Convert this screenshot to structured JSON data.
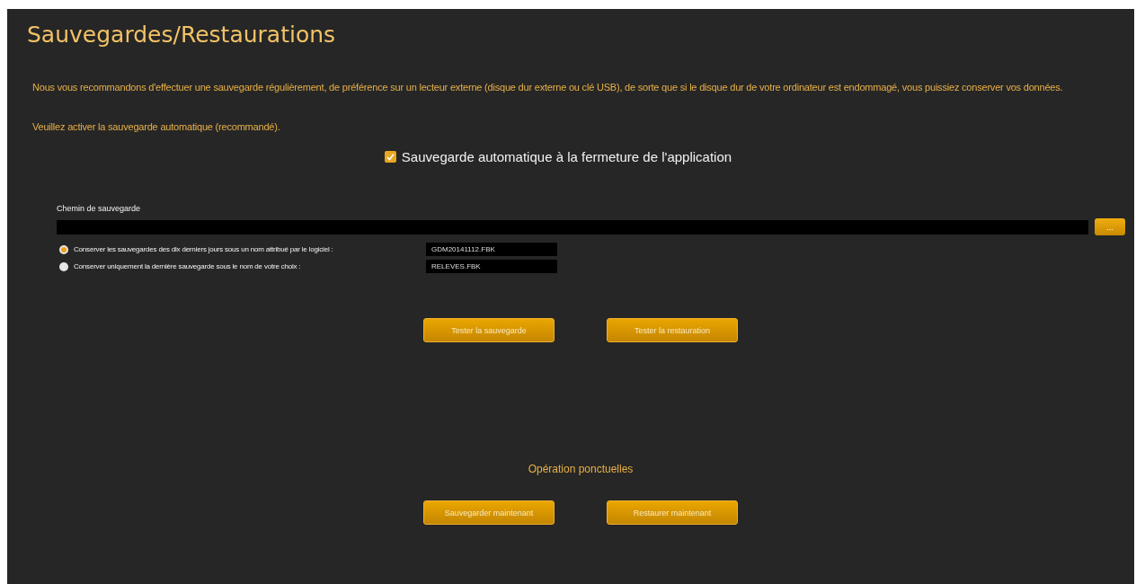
{
  "title": "Sauvegardes/Restaurations",
  "intro": "Nous vous recommandons d'effectuer une sauvegarde régulièrement, de préférence sur un lecteur externe (disque dur externe ou clé USB), de sorte que si le disque dur de votre ordinateur est endommagé, vous puissiez conserver vos données.",
  "advice": "Veuillez activer la sauvegarde automatique (recommandé).",
  "auto_backup": {
    "label": "Sauvegarde automatique à la fermeture de l'application",
    "checked": true
  },
  "path": {
    "label": "Chemin de sauvegarde",
    "browse": "..."
  },
  "options": [
    {
      "label": "Conserver les sauvegardes des dix derniers jours sous un nom attribué par le logiciel :",
      "value": "GDM20141112.FBK",
      "selected": true
    },
    {
      "label": "Conserver uniquement la dernière sauvegarde sous le nom de votre choix :",
      "value": "RELEVES.FBK",
      "selected": false
    }
  ],
  "test_buttons": [
    "Tester la sauvegarde",
    "Tester la restauration"
  ],
  "oneoff": {
    "title": "Opération ponctuelles",
    "buttons": [
      "Sauvegarder maintenant",
      "Restaurer maintenant"
    ]
  }
}
